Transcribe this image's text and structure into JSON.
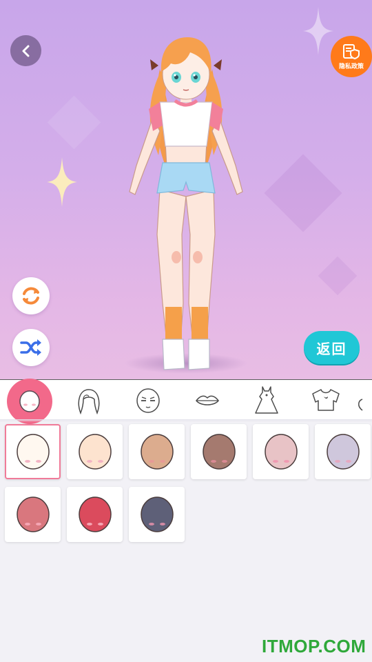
{
  "header": {
    "privacy_label": "隐私政策",
    "return_label": "返回"
  },
  "icons": {
    "back": "chevron-left-icon",
    "privacy": "privacy-shield-icon",
    "reset": "refresh-icon",
    "random": "shuffle-icon"
  },
  "categories": [
    {
      "name": "face",
      "icon": "face-icon",
      "active": true
    },
    {
      "name": "hair",
      "icon": "hair-icon",
      "active": false
    },
    {
      "name": "expression",
      "icon": "expression-icon",
      "active": false
    },
    {
      "name": "lips",
      "icon": "lips-icon",
      "active": false
    },
    {
      "name": "dress",
      "icon": "dress-icon",
      "active": false
    },
    {
      "name": "top",
      "icon": "top-icon",
      "active": false
    },
    {
      "name": "more",
      "icon": "more-icon",
      "active": false
    }
  ],
  "skin_tones": [
    {
      "color": "#fff8f0",
      "selected": true
    },
    {
      "color": "#fde3cf",
      "selected": false
    },
    {
      "color": "#dcac8e",
      "selected": false
    },
    {
      "color": "#a57a6f",
      "selected": false
    },
    {
      "color": "#e8c3c6",
      "selected": false
    },
    {
      "color": "#cfc7dc",
      "selected": false
    },
    {
      "color": "#d9777e",
      "selected": false
    },
    {
      "color": "#db4b5d",
      "selected": false
    },
    {
      "color": "#5e6078",
      "selected": false
    }
  ],
  "colors": {
    "accent_pink": "#f2698a",
    "return_button": "#20c7d6",
    "privacy_button": "#ff7a1a"
  },
  "watermark": "ITMOP.COM"
}
